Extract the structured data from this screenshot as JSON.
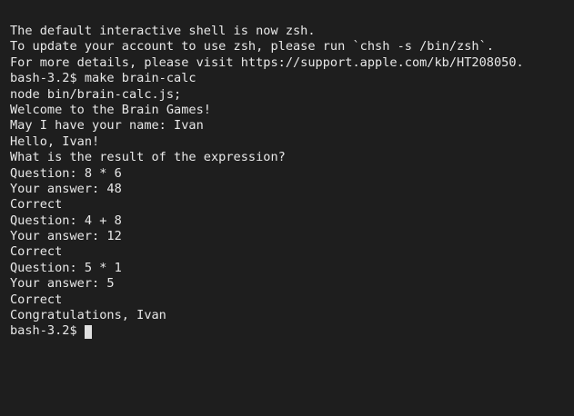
{
  "terminal": {
    "lines": [
      "The default interactive shell is now zsh.",
      "To update your account to use zsh, please run `chsh -s /bin/zsh`.",
      "For more details, please visit https://support.apple.com/kb/HT208050.",
      "bash-3.2$ make brain-calc",
      "node bin/brain-calc.js;",
      "Welcome to the Brain Games!",
      "May I have your name: Ivan",
      "Hello, Ivan!",
      "What is the result of the expression?",
      "Question: 8 * 6",
      "Your answer: 48",
      "Correct",
      "Question: 4 + 8",
      "Your answer: 12",
      "Correct",
      "Question: 5 * 1",
      "Your answer: 5",
      "Correct",
      "Congratulations, Ivan"
    ],
    "prompt": "bash-3.2$"
  }
}
